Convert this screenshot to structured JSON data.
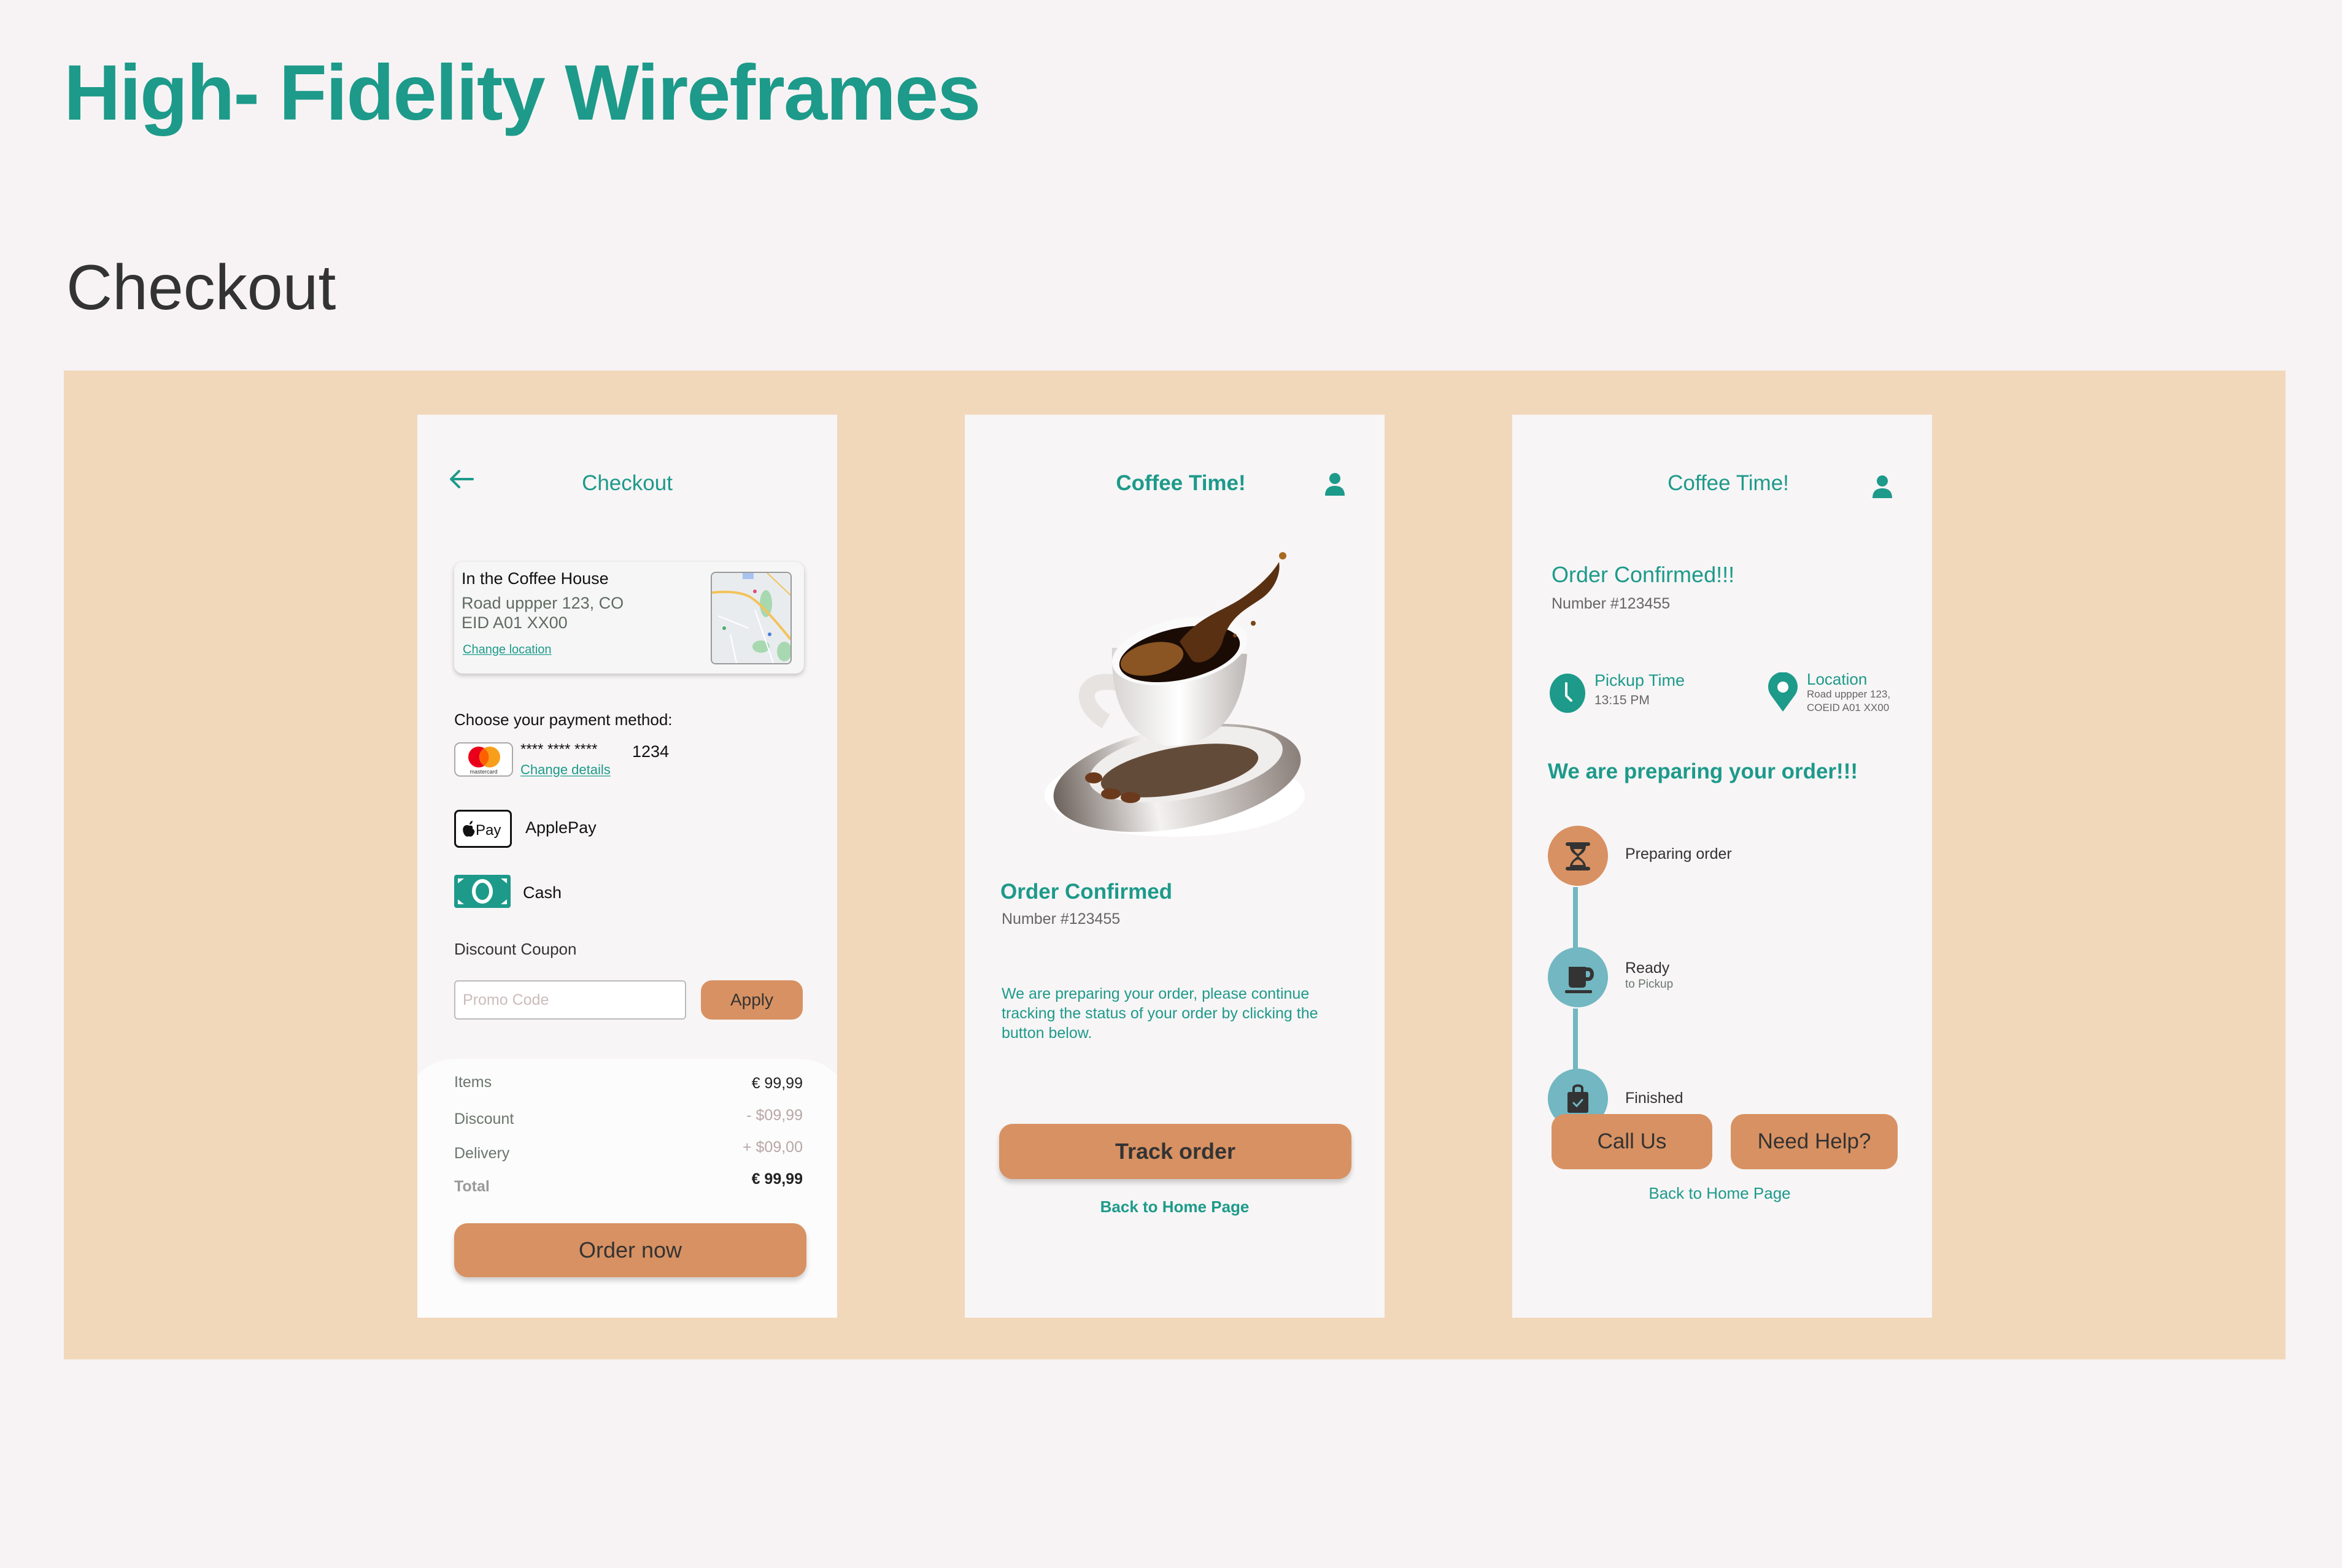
{
  "document": {
    "title": "High- Fidelity Wireframes",
    "section": "Checkout"
  },
  "colors": {
    "brand_teal": "#1d9a8a",
    "button_orange": "#d89162",
    "band_peach": "#f1d8ba",
    "step_blue": "#72b7c1",
    "page_bg": "#f7f3f4"
  },
  "screen_checkout": {
    "back_icon": "arrow-left-icon",
    "title": "Checkout",
    "location": {
      "name": "In the Coffee House",
      "address_line1": "Road uppper 123, CO",
      "address_line2": "EID A01 XX00",
      "change_link": "Change location",
      "map_icon": "map-thumbnail"
    },
    "payment_heading": "Choose your payment method:",
    "payment_methods": [
      {
        "icon": "mastercard-icon",
        "icon_label": "mastercard",
        "masked": "****   ****  ****",
        "last4": "1234",
        "change_link": "Change details"
      },
      {
        "icon": "apple-pay-icon",
        "icon_label": "Pay",
        "label": "ApplePay"
      },
      {
        "icon": "cash-icon",
        "label": "Cash"
      }
    ],
    "coupon_heading": "Discount Coupon",
    "promo_placeholder": "Promo Code",
    "promo_value": "",
    "apply_label": "Apply",
    "summary": [
      {
        "label": "Items",
        "value": "€ 99,99"
      },
      {
        "label": "Discount",
        "value": "- $09,99"
      },
      {
        "label": "Delivery",
        "value": "+ $09,00"
      },
      {
        "label": "Total",
        "value": "€ 99,99"
      }
    ],
    "order_button": "Order now"
  },
  "screen_confirmed": {
    "title": "Coffee Time!",
    "profile_icon": "user-icon",
    "hero_image": "coffee-cup-illustration",
    "heading": "Order Confirmed",
    "order_number": "Number #123455",
    "message": "We are preparing your order, please continue tracking the status of your order by clicking the button below.",
    "track_button": "Track order",
    "home_link": "Back to Home Page"
  },
  "screen_tracking": {
    "title": "Coffee Time!",
    "profile_icon": "user-icon",
    "heading": "Order Confirmed!!!",
    "order_number": "Number #123455",
    "pickup": {
      "icon": "clock-icon",
      "label": "Pickup Time",
      "value": "13:15 PM"
    },
    "location": {
      "icon": "map-pin-icon",
      "label": "Location",
      "line1": "Road uppper 123,",
      "line2": "COEID A01 XX00"
    },
    "status_heading": "We are preparing your order!!!",
    "steps": [
      {
        "icon": "hourglass-icon",
        "label": "Preparing order",
        "sublabel": "",
        "state": "active"
      },
      {
        "icon": "coffee-mug-icon",
        "label": "Ready",
        "sublabel": "to Pickup",
        "state": "pending"
      },
      {
        "icon": "shopping-bag-check-icon",
        "label": "Finished",
        "sublabel": "",
        "state": "pending"
      }
    ],
    "call_button": "Call Us",
    "help_button": "Need Help?",
    "home_link": "Back to Home Page"
  }
}
